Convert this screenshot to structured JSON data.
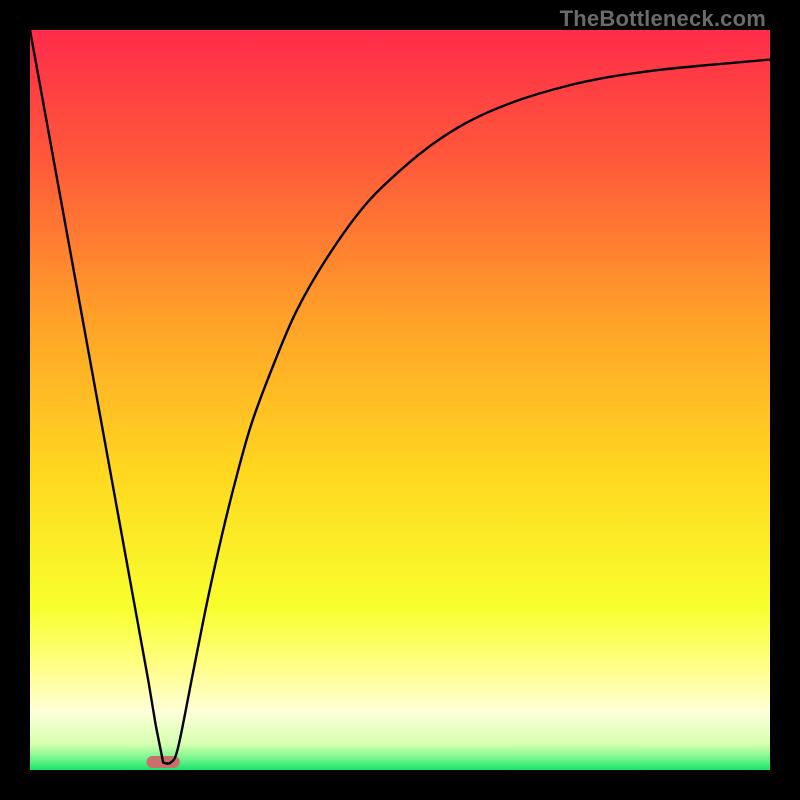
{
  "watermark": "TheBottleneck.com",
  "chart_data": {
    "type": "line",
    "title": "",
    "xlabel": "",
    "ylabel": "",
    "xlim": [
      0,
      100
    ],
    "ylim": [
      0,
      100
    ],
    "grid": false,
    "legend": false,
    "background_gradient": {
      "stops": [
        {
          "offset": 0.0,
          "color": "#ff2c4a"
        },
        {
          "offset": 0.18,
          "color": "#ff5a3a"
        },
        {
          "offset": 0.4,
          "color": "#ffa428"
        },
        {
          "offset": 0.6,
          "color": "#ffd820"
        },
        {
          "offset": 0.78,
          "color": "#f8ff2d"
        },
        {
          "offset": 0.86,
          "color": "#ffff86"
        },
        {
          "offset": 0.92,
          "color": "#ffffd8"
        },
        {
          "offset": 0.965,
          "color": "#d7ffb0"
        },
        {
          "offset": 0.985,
          "color": "#72f58a"
        },
        {
          "offset": 1.0,
          "color": "#18e56a"
        }
      ]
    },
    "series": [
      {
        "name": "bottleneck-curve",
        "x": [
          0,
          4,
          8,
          12,
          14,
          16,
          17,
          18,
          19,
          20,
          22,
          24,
          26,
          28,
          30,
          33,
          36,
          40,
          45,
          50,
          55,
          60,
          66,
          72,
          78,
          85,
          92,
          100
        ],
        "y": [
          100,
          78,
          56,
          34,
          23,
          12,
          6,
          1,
          1,
          3,
          13,
          23,
          32,
          40,
          47,
          55,
          62,
          69,
          76,
          81,
          85,
          88,
          90.5,
          92.3,
          93.6,
          94.6,
          95.3,
          96
        ]
      }
    ],
    "marker": {
      "name": "optimal-marker",
      "x": 18,
      "y": 0,
      "width_pct": 4.5,
      "color": "#cc6f6a"
    }
  }
}
